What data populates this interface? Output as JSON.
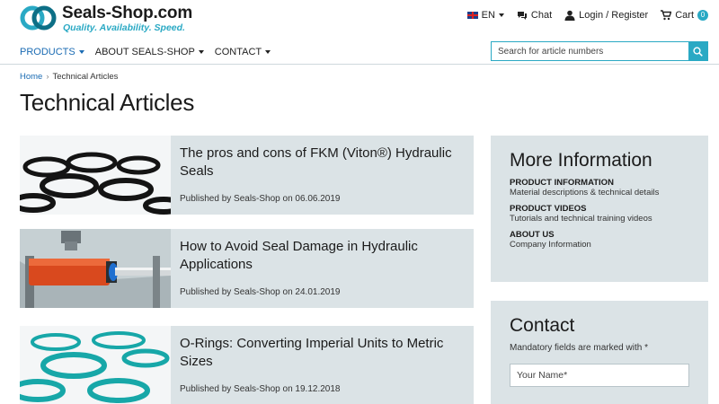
{
  "brand": {
    "name": "Seals-Shop.com",
    "tagline": "Quality. Availability. Speed.",
    "accent_color": "#2aa9c4"
  },
  "top_links": {
    "language": "EN",
    "chat": "Chat",
    "login": "Login / Register",
    "cart": "Cart",
    "cart_count": "0"
  },
  "nav": [
    {
      "label": "PRODUCTS"
    },
    {
      "label": "ABOUT SEALS-SHOP"
    },
    {
      "label": "CONTACT"
    }
  ],
  "search": {
    "placeholder": "Search for article numbers"
  },
  "breadcrumb": {
    "home": "Home",
    "separator": "›",
    "current": "Technical Articles"
  },
  "page_title": "Technical Articles",
  "articles": [
    {
      "title": "The pros and cons of FKM (Viton®) Hydraulic Seals",
      "meta": "Published by Seals-Shop on 06.06.2019",
      "thumb": "black-o-rings-image"
    },
    {
      "title": "How to Avoid Seal Damage in Hydraulic Applications",
      "meta": "Published by Seals-Shop on 24.01.2019",
      "thumb": "hydraulic-cylinder-image"
    },
    {
      "title": "O-Rings: Converting Imperial Units to Metric Sizes",
      "meta": "Published by Seals-Shop on 19.12.2018",
      "thumb": "teal-o-rings-image"
    }
  ],
  "sidebar": {
    "more_info": {
      "title": "More Information",
      "entries": [
        {
          "heading": "PRODUCT INFORMATION",
          "desc": "Material descriptions & technical details"
        },
        {
          "heading": "PRODUCT VIDEOS",
          "desc": "Tutorials and technical training videos"
        },
        {
          "heading": "ABOUT US",
          "desc": "Company Information"
        }
      ]
    },
    "contact": {
      "title": "Contact",
      "mandatory_note": "Mandatory fields are marked with *",
      "name_placeholder": "Your Name*"
    }
  }
}
